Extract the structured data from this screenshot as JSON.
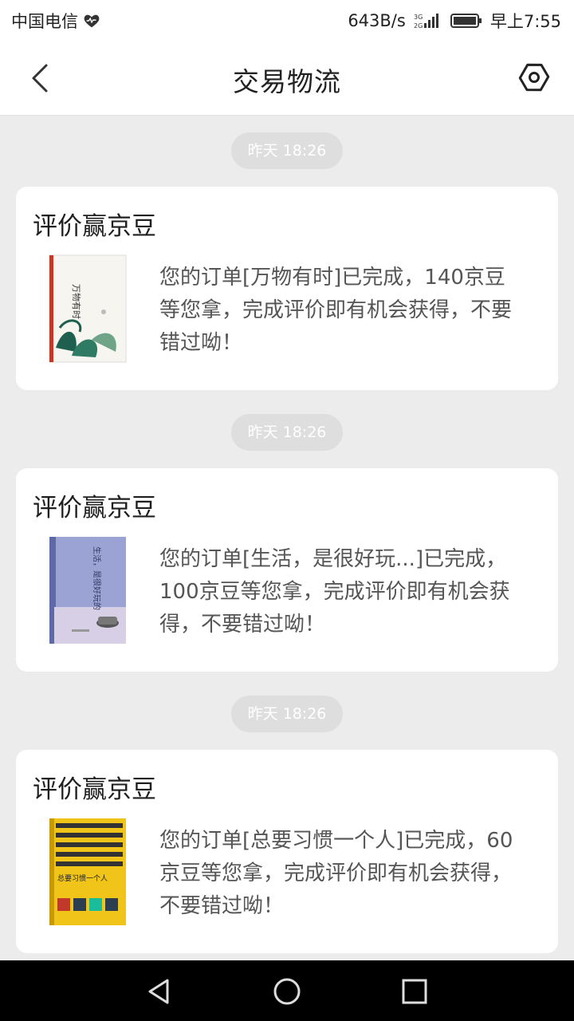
{
  "status_bar": {
    "carrier": "中国电信",
    "net_speed": "643B/s",
    "network": "3G 2G",
    "time": "早上7:55"
  },
  "header": {
    "title": "交易物流"
  },
  "messages": [
    {
      "time": "昨天 18:26",
      "title": "评价赢京豆",
      "text": "您的订单[万物有时]已完成，140京豆等您拿，完成评价即有机会获得，不要错过呦！",
      "thumb_text": "万物有时"
    },
    {
      "time": "昨天 18:26",
      "title": "评价赢京豆",
      "text": "您的订单[生活，是很好玩...]已完成，100京豆等您拿，完成评价即有机会获得，不要错过呦！",
      "thumb_text": "生活，是很好玩的"
    },
    {
      "time": "昨天 18:26",
      "title": "评价赢京豆",
      "text": "您的订单[总要习惯一个人]已完成，60京豆等您拿，完成评价即有机会获得，不要错过呦！",
      "thumb_text": "总要习惯一个人"
    }
  ]
}
